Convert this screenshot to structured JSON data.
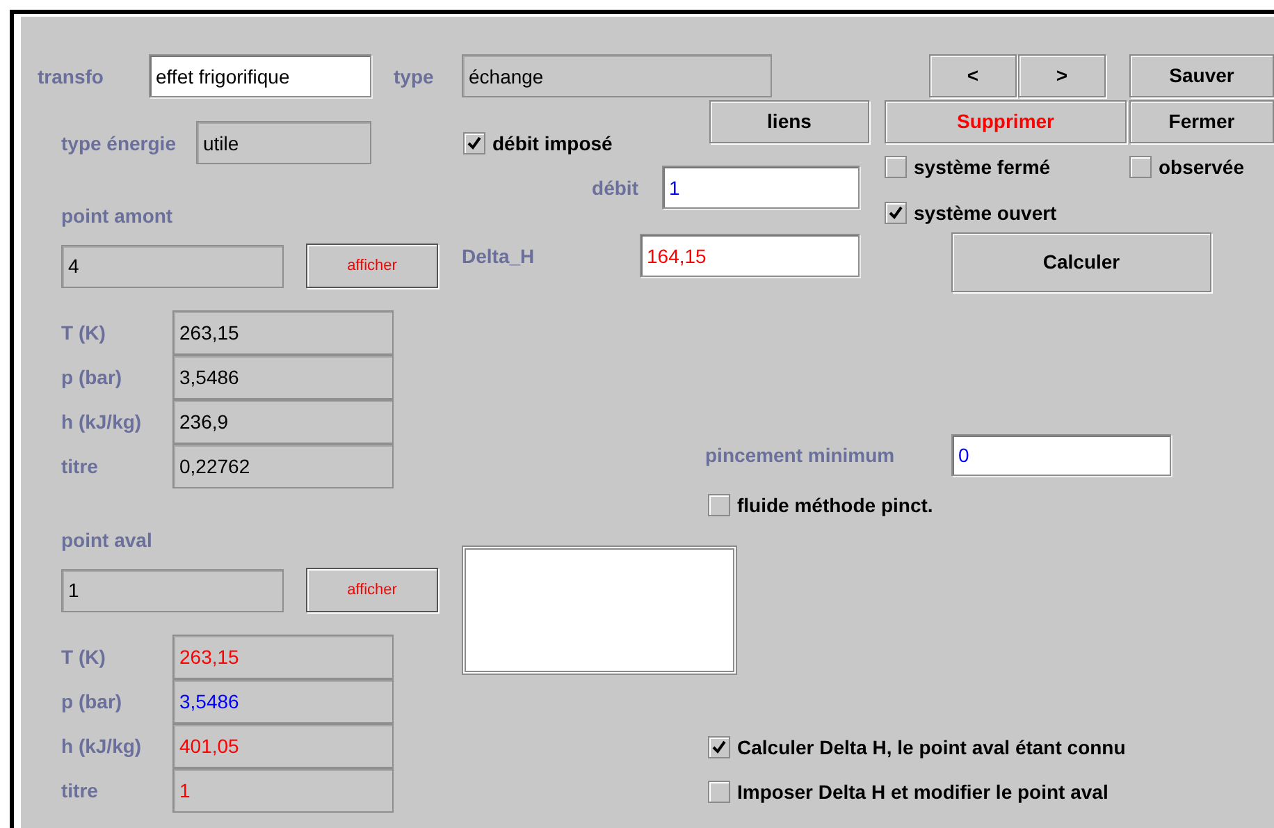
{
  "transfo": {
    "label": "transfo",
    "value": "effet frigorifique",
    "disabled": false
  },
  "type": {
    "label": "type",
    "value": "échange",
    "disabled": true
  },
  "type_energie": {
    "label": "type énergie",
    "value": "utile",
    "disabled": true
  },
  "point_amont": {
    "label": "point amont",
    "value": "4",
    "disabled": true,
    "button": "afficher",
    "properties": [
      {
        "label": "T (K)",
        "value": "263,15",
        "color": "#000000"
      },
      {
        "label": "p (bar)",
        "value": "3,5486",
        "color": "#000000"
      },
      {
        "label": "h (kJ/kg)",
        "value": "236,9",
        "color": "#000000"
      },
      {
        "label": "titre",
        "value": "0,22762",
        "color": "#000000"
      }
    ]
  },
  "point_aval": {
    "label": "point aval",
    "value": "1",
    "disabled": true,
    "button": "afficher",
    "properties": [
      {
        "label": "T (K)",
        "value": "263,15",
        "color": "#ff0000"
      },
      {
        "label": "p (bar)",
        "value": "3,5486",
        "color": "#0000ff"
      },
      {
        "label": "h (kJ/kg)",
        "value": "401,05",
        "color": "#ff0000"
      },
      {
        "label": "titre",
        "value": "1",
        "color": "#ff0000"
      }
    ]
  },
  "debit_impose": {
    "label": "débit imposé",
    "checked": true
  },
  "debit": {
    "label": "débit",
    "value": "1",
    "disabled": false
  },
  "delta_h": {
    "label": "Delta_H",
    "value": "164,15",
    "disabled": false
  },
  "buttons": {
    "prev": "<",
    "next": ">",
    "save": "Sauver",
    "links": "liens",
    "delete": "Supprimer",
    "close": "Fermer",
    "compute": "Calculer"
  },
  "systeme": [
    {
      "label": "système fermé",
      "checked": false
    },
    {
      "label": "système ouvert",
      "checked": true
    }
  ],
  "observee": {
    "label": "observée",
    "checked": false
  },
  "pincement": {
    "label": "pincement minimum",
    "value": "0",
    "disabled": false
  },
  "fluide_methode": {
    "label": "fluide méthode pinct.",
    "checked": false
  },
  "modes": [
    {
      "label": "Calculer Delta H, le point aval étant connu",
      "checked": true
    },
    {
      "label": "Imposer Delta H et modifier le point aval",
      "checked": false
    }
  ]
}
